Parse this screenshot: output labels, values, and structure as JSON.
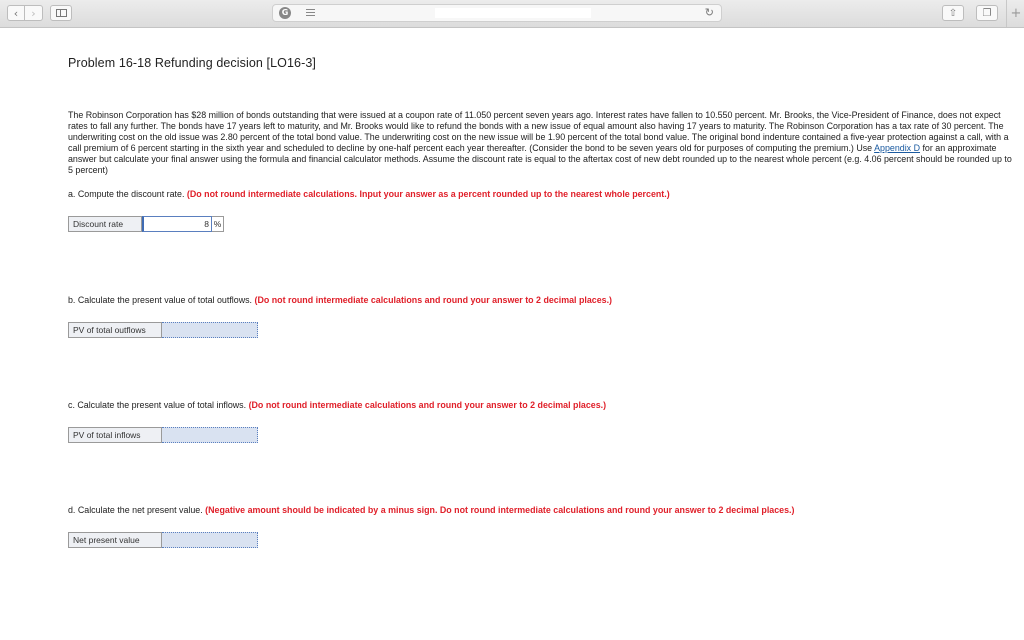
{
  "browser": {
    "url": "",
    "icons": {
      "back": "chevron-left-icon",
      "forward": "chevron-right-icon",
      "sidebar": "sidebar-icon",
      "shield": "shield-icon",
      "reader": "reader-icon",
      "reload": "reload-icon",
      "share": "share-icon",
      "tabs": "tabs-icon",
      "new_tab": "plus-icon"
    }
  },
  "page": {
    "title": "Problem 16-18 Refunding decision [LO16-3]",
    "problem_text_1": "The Robinson Corporation has $28 million of bonds outstanding that were issued at a coupon rate of 11.050 percent seven years ago. Interest rates have fallen to 10.550 percent. Mr. Brooks, the Vice-President of Finance, does not expect rates to fall any further. The bonds have 17 years left to maturity, and Mr. Brooks would like to refund the bonds with a new issue of equal amount also having 17 years to maturity. The Robinson Corporation has a tax rate of 30 percent. The underwriting cost on the old issue was 2.80 percent of the total bond value. The underwriting cost on the new issue will be 1.90 percent of the total bond value. The original bond indenture contained a five-year protection against a call, with a call premium of 6 percent  starting in the sixth year and scheduled to decline by one-half percent each year thereafter. (Consider the bond to be seven years old for purposes of computing the premium.) Use ",
    "appendix_link": "Appendix D",
    "problem_text_2": " for an approximate answer but calculate your final answer using the formula and financial calculator methods. Assume the discount rate is equal to the aftertax cost of new debt rounded up to the nearest whole percent (e.g. 4.06 percent should be rounded up to 5 percent)",
    "questions": [
      {
        "prompt": "a. Compute the discount rate. ",
        "instruction": "(Do not round intermediate calculations. Input your answer as a percent rounded up to the nearest whole percent.)",
        "label": "Discount rate",
        "value": "8",
        "unit": "%"
      },
      {
        "prompt": "b. Calculate the present value of total outflows. ",
        "instruction": "(Do not round intermediate calculations and round your answer to 2 decimal places.)",
        "label": "PV of total outflows",
        "value": ""
      },
      {
        "prompt": "c. Calculate the present value of total inflows. ",
        "instruction": "(Do not round intermediate calculations and round your answer to 2 decimal places.)",
        "label": "PV of total inflows",
        "value": ""
      },
      {
        "prompt": "d. Calculate the net present value. ",
        "instruction": "(Negative amount should be indicated by a minus sign. Do not round intermediate calculations and round your answer to 2 decimal places.)",
        "label": "Net present value",
        "value": ""
      }
    ]
  }
}
